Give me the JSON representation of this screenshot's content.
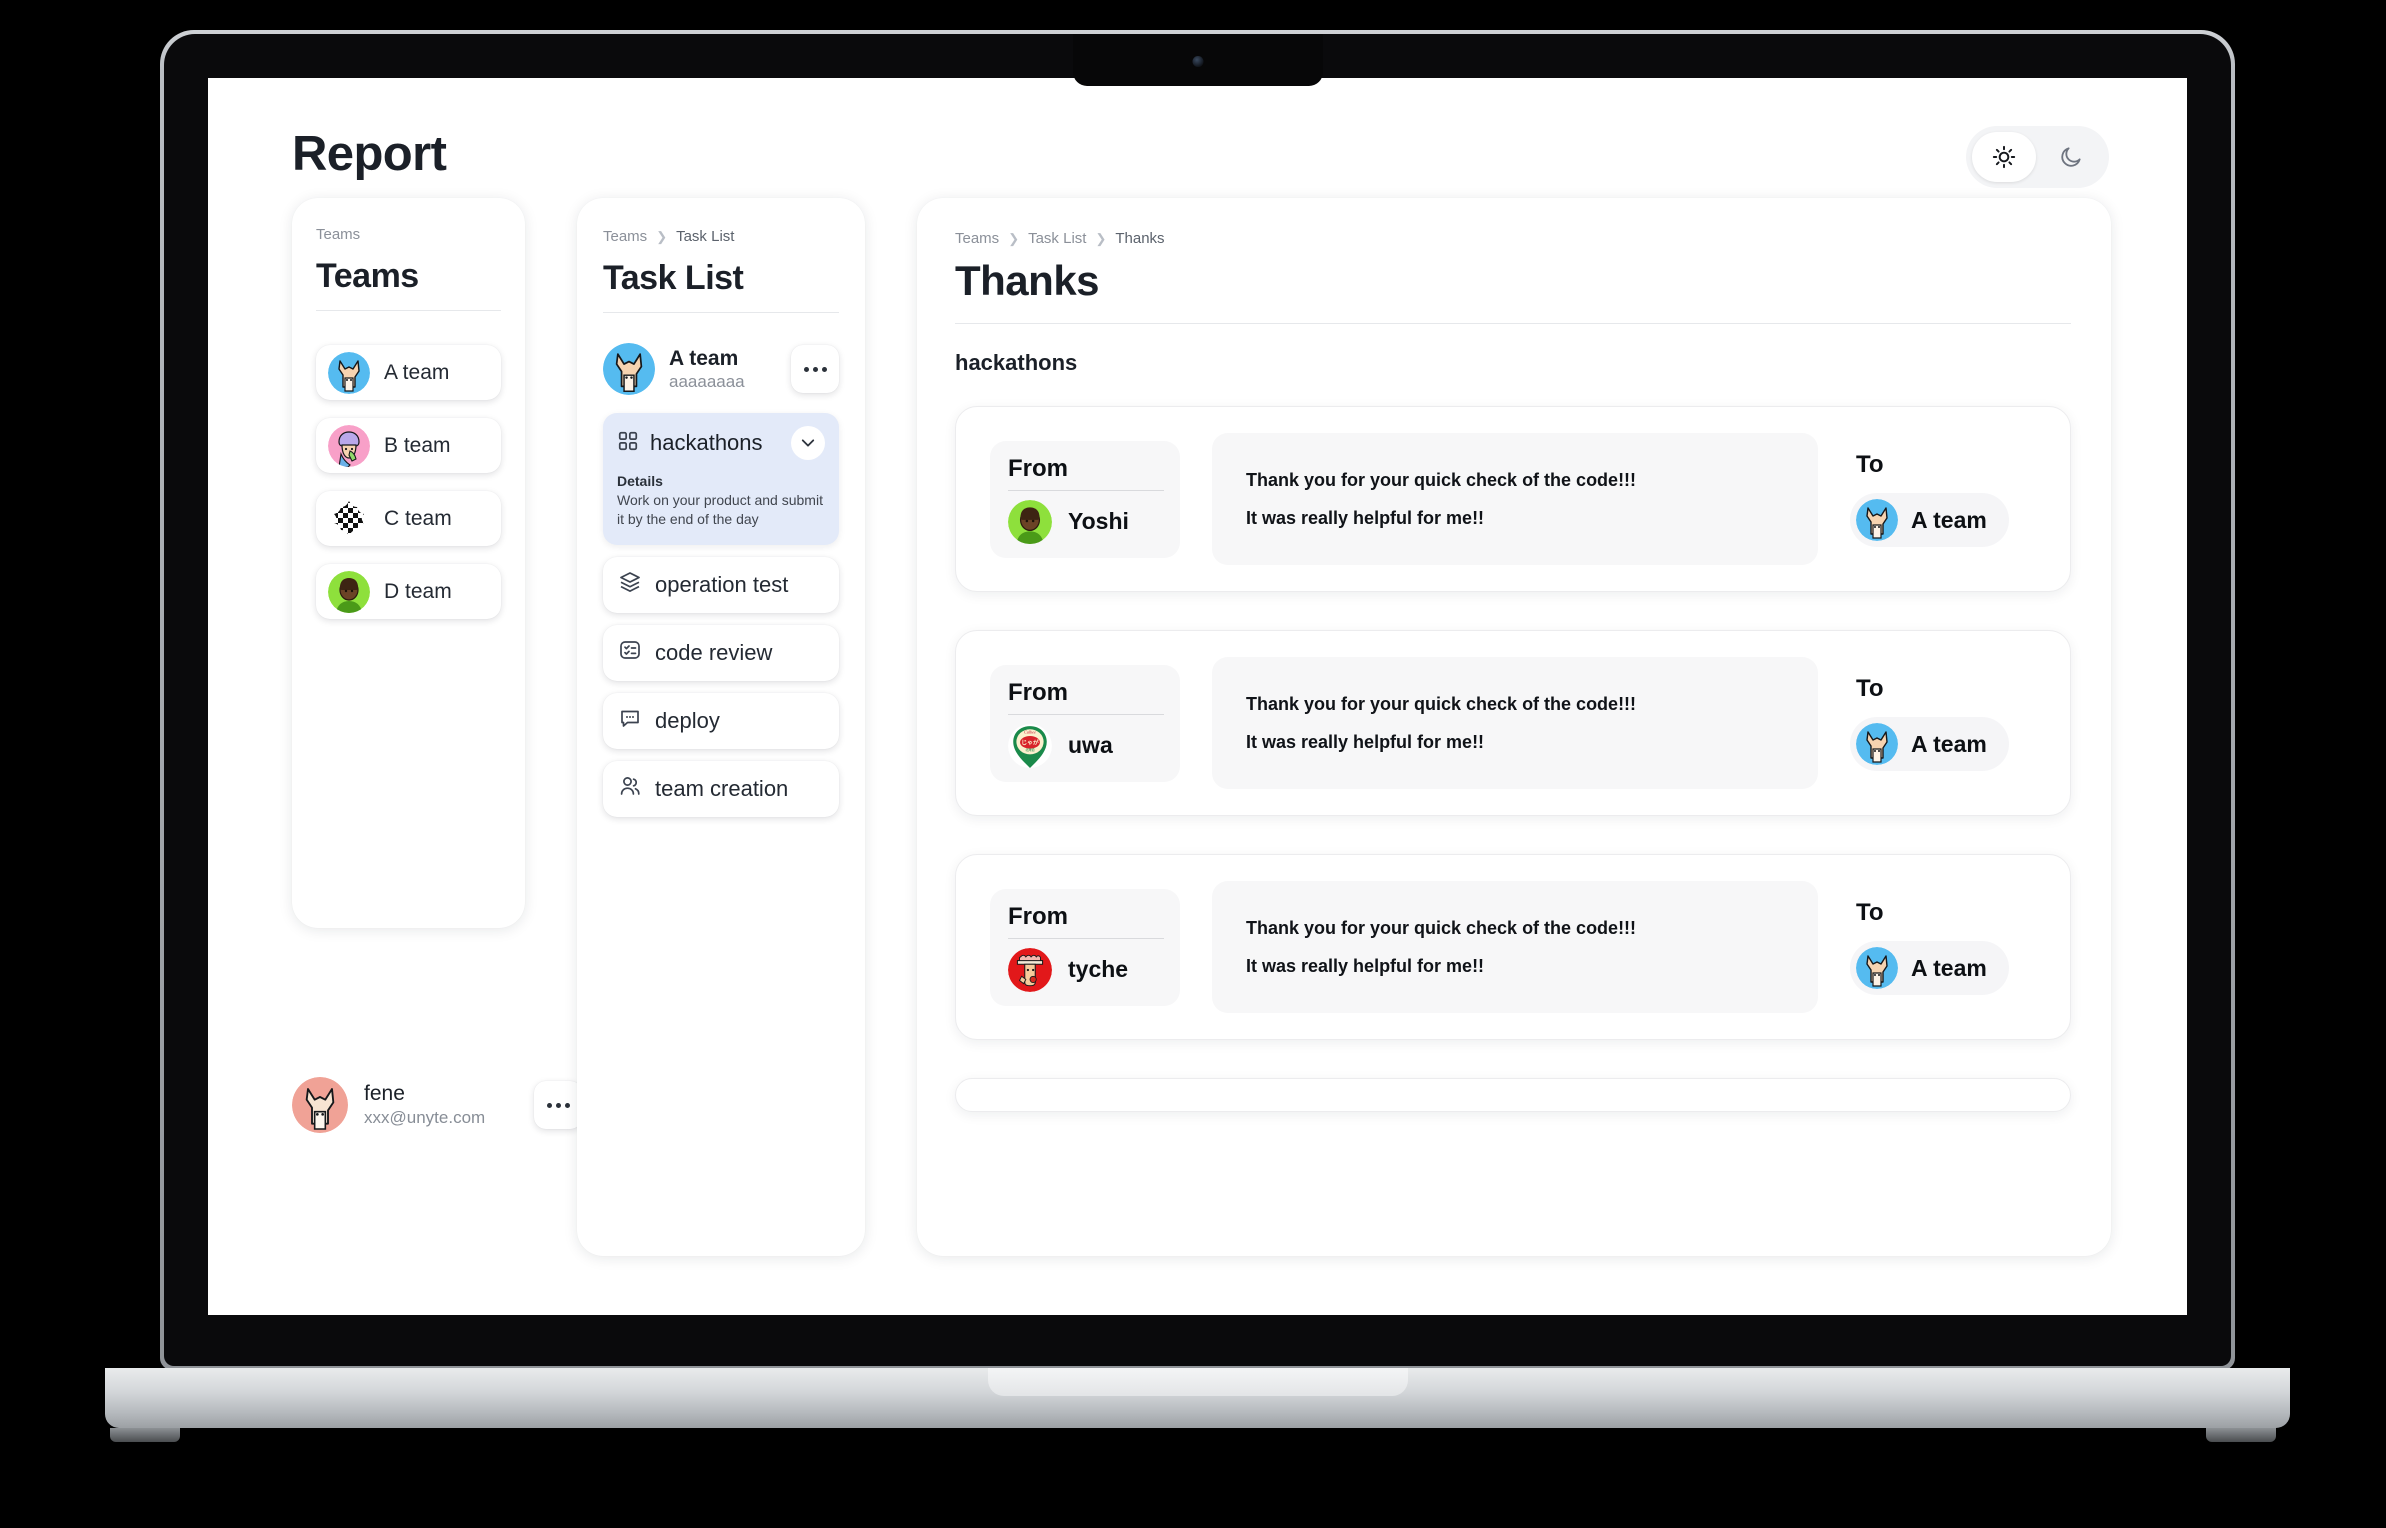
{
  "app": {
    "title": "Report"
  },
  "theme_toggle": {
    "light_icon": "sun-icon",
    "dark_icon": "moon-icon",
    "active": "light"
  },
  "teams_panel": {
    "breadcrumb": [
      "Teams"
    ],
    "title": "Teams",
    "items": [
      {
        "label": "A team",
        "avatar": "alpaca-blue"
      },
      {
        "label": "B team",
        "avatar": "person-pink"
      },
      {
        "label": "C team",
        "avatar": "checker-black"
      },
      {
        "label": "D team",
        "avatar": "person-green"
      }
    ]
  },
  "user": {
    "name": "fene",
    "email": "xxx@unyte.com",
    "avatar": "alpaca-salmon",
    "menu_icon": "ellipsis-icon"
  },
  "tasks_panel": {
    "breadcrumb": [
      "Teams",
      "Task List"
    ],
    "title": "Task List",
    "team": {
      "name": "A team",
      "sub": "aaaaaaaa",
      "avatar": "alpaca-blue",
      "menu_icon": "ellipsis-icon"
    },
    "expanded_task": {
      "icon": "grid-icon",
      "title": "hackathons",
      "chevron": "chevron-down-icon",
      "details_label": "Details",
      "details_text": "Work on your product and submit it by the end of the day"
    },
    "items": [
      {
        "label": "operation test",
        "icon": "layers-icon"
      },
      {
        "label": "code review",
        "icon": "checklist-icon"
      },
      {
        "label": "deploy",
        "icon": "message-dots-icon"
      },
      {
        "label": "team creation",
        "icon": "users-icon"
      }
    ]
  },
  "main_panel": {
    "breadcrumb": [
      "Teams",
      "Task List",
      "Thanks"
    ],
    "title": "Thanks",
    "section_label": "hackathons",
    "from_label": "From",
    "to_label": "To",
    "cards": [
      {
        "from_name": "Yoshi",
        "from_avatar": "person-green",
        "message": [
          "Thank you for your quick check of the code!!!",
          "It was really helpful for me!!"
        ],
        "to_name": "A team",
        "to_avatar": "alpaca-blue"
      },
      {
        "from_name": "uwa",
        "from_avatar": "calbee-chip",
        "message": [
          "Thank you for your quick check of the code!!!",
          "It was really helpful for me!!"
        ],
        "to_name": "A team",
        "to_avatar": "alpaca-blue"
      },
      {
        "from_name": "tyche",
        "from_avatar": "red-mascot",
        "message": [
          "Thank you for your quick check of the code!!!",
          "It was really helpful for me!!"
        ],
        "to_name": "A team",
        "to_avatar": "alpaca-blue"
      }
    ]
  },
  "colors": {
    "accent_light_blue": "#e3eaf9",
    "text_dark": "#1b2028",
    "text_muted": "#8b9099",
    "panel_bg": "#ffffff",
    "chip_bg": "#f7f7f8"
  }
}
